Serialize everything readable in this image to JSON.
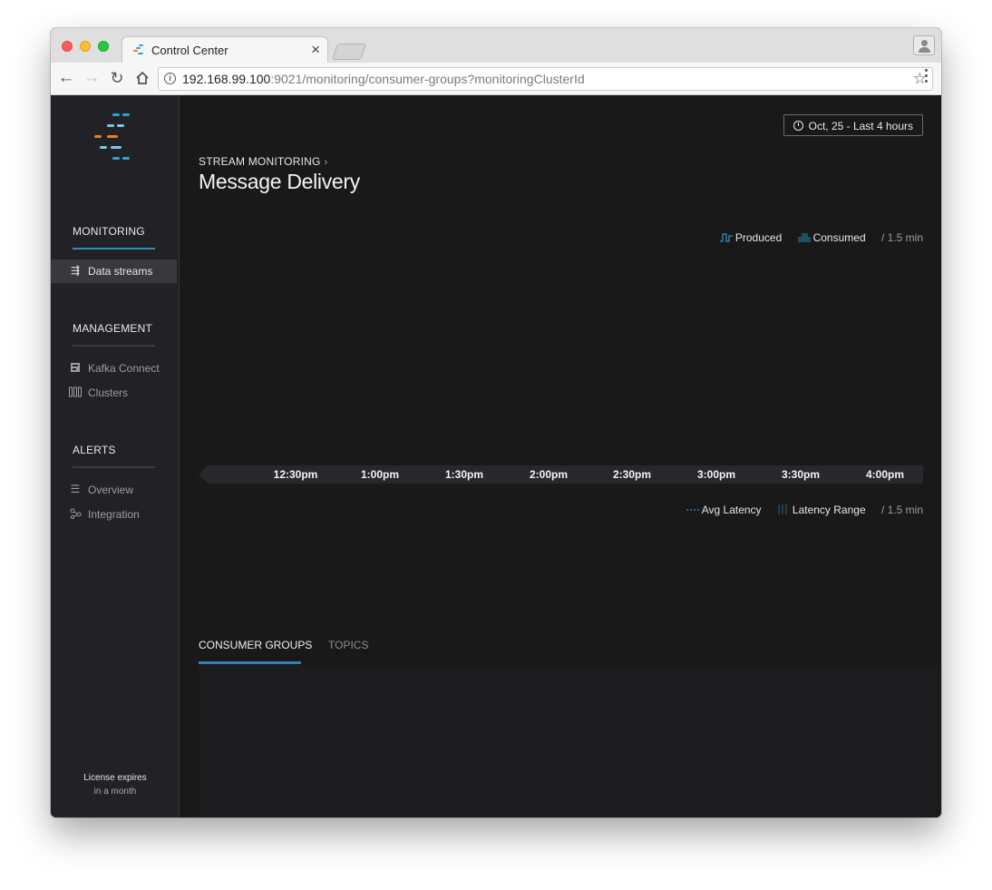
{
  "browser": {
    "tab_title": "Control Center",
    "tab_close": "×",
    "url_host": "192.168.99.100",
    "url_rest": ":9021/monitoring/consumer-groups?monitoringClusterId"
  },
  "sidebar": {
    "sections": [
      {
        "title": "MONITORING",
        "items": [
          {
            "label": "Data streams",
            "icon": "data-streams-icon",
            "active": true
          }
        ]
      },
      {
        "title": "MANAGEMENT",
        "items": [
          {
            "label": "Kafka Connect",
            "icon": "kafka-connect-icon"
          },
          {
            "label": "Clusters",
            "icon": "clusters-icon"
          }
        ]
      },
      {
        "title": "ALERTS",
        "items": [
          {
            "label": "Overview",
            "icon": "list-icon"
          },
          {
            "label": "Integration",
            "icon": "integration-icon"
          }
        ]
      }
    ],
    "license_line1": "License expires",
    "license_line2": "in a month"
  },
  "header": {
    "time_range": "Oct, 25 - Last 4 hours",
    "breadcrumb": "STREAM MONITORING",
    "title": "Message Delivery"
  },
  "delivery_legend": {
    "produced": "Produced",
    "consumed": "Consumed",
    "interval": "/ 1.5 min"
  },
  "latency_legend": {
    "avg": "Avg Latency",
    "range": "Latency Range",
    "interval": "/ 1.5 min"
  },
  "time_axis": {
    "ticks": [
      "12:30pm",
      "1:00pm",
      "1:30pm",
      "2:00pm",
      "2:30pm",
      "3:00pm",
      "3:30pm",
      "4:00pm"
    ]
  },
  "page_tabs": [
    {
      "label": "CONSUMER GROUPS",
      "active": true
    },
    {
      "label": "TOPICS",
      "active": false
    }
  ],
  "colors": {
    "accent": "#2c8fbd",
    "logo_blue": "#2ca3d6",
    "logo_orange": "#ef7b1f"
  }
}
